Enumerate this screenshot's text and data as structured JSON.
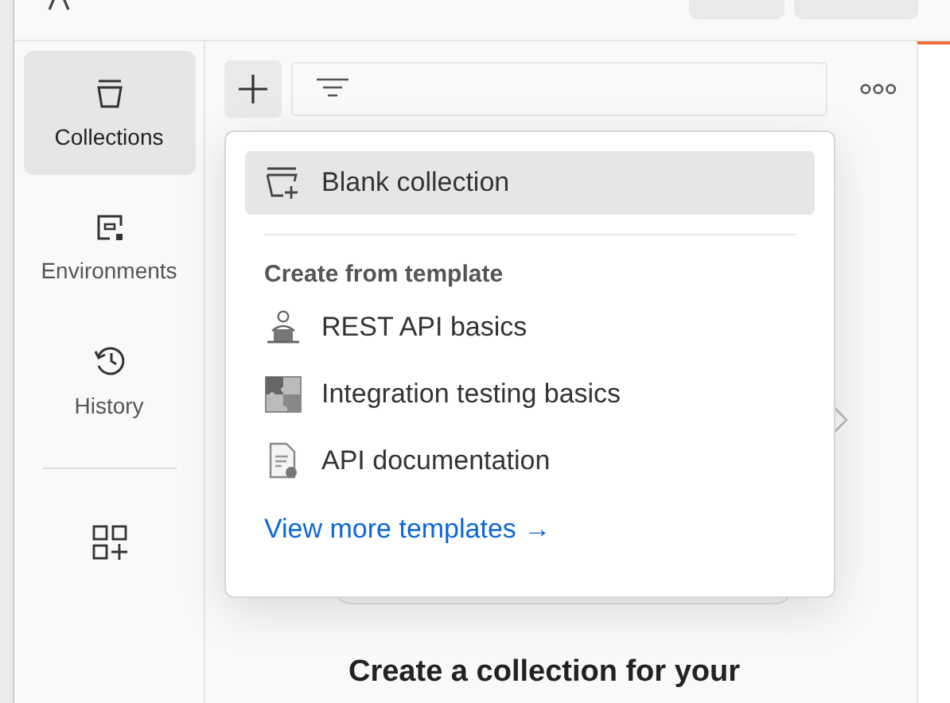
{
  "sidebar": {
    "items": [
      {
        "label": "Collections",
        "kind": "collections",
        "selected": true
      },
      {
        "label": "Environments",
        "kind": "environments",
        "selected": false
      },
      {
        "label": "History",
        "kind": "history",
        "selected": false
      }
    ]
  },
  "menu": {
    "items": [
      {
        "label": "Blank collection",
        "selected": true
      }
    ],
    "section_title": "Create from template",
    "templates": [
      {
        "label": "REST API basics",
        "kind": "rest"
      },
      {
        "label": "Integration testing basics",
        "kind": "integration"
      },
      {
        "label": "API documentation",
        "kind": "docs"
      }
    ],
    "link": "View more templates →"
  },
  "empty_state": {
    "heading": "Create a collection for your"
  }
}
